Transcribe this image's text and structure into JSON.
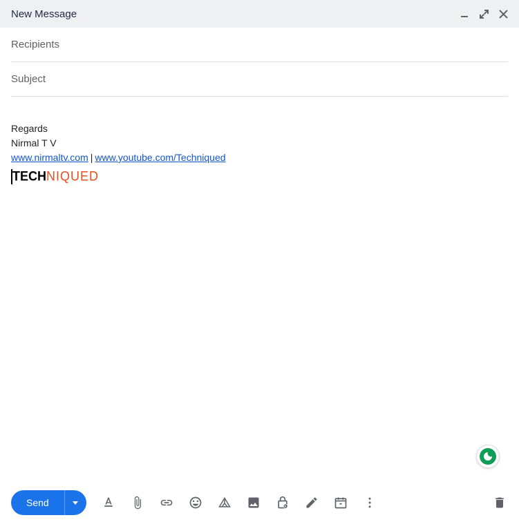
{
  "header": {
    "title": "New Message"
  },
  "fields": {
    "recipients_placeholder": "Recipients",
    "subject_placeholder": "Subject"
  },
  "signature": {
    "regards": "Regards",
    "name": "Nirmal T V",
    "link1_text": "www.nirmaltv.com",
    "separator": "|",
    "link2_text": "www.youtube.com/Techniqued",
    "logo_part1": "TECH",
    "logo_part2": "NIQUED"
  },
  "footer": {
    "send_label": "Send"
  }
}
